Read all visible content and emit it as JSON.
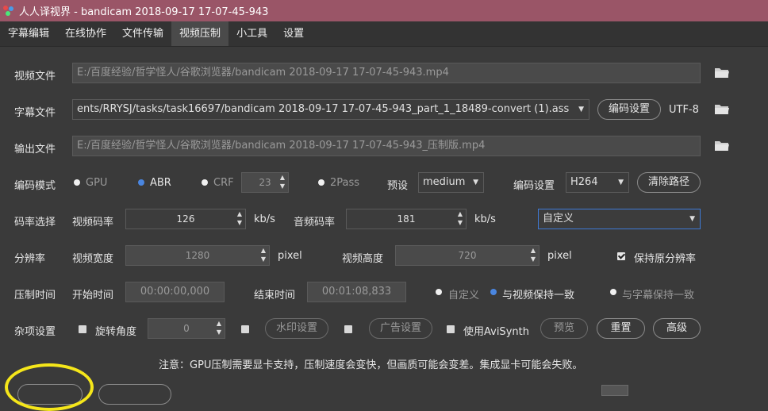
{
  "window": {
    "title": "人人译视界 - bandicam 2018-09-17 17-07-45-943"
  },
  "menu": [
    "字幕编辑",
    "在线协作",
    "文件传输",
    "视频压制",
    "小工具",
    "设置"
  ],
  "video_file": {
    "label": "视频文件",
    "value": "E:/百度经验/哲学怪人/谷歌浏览器/bandicam 2018-09-17 17-07-45-943.mp4"
  },
  "subtitle_file": {
    "label": "字幕文件",
    "value": "ents/RRYSJ/tasks/task16697/bandicam 2018-09-17 17-07-45-943_part_1_18489-convert (1).ass",
    "encode_btn": "编码设置",
    "encoding": "UTF-8"
  },
  "output_file": {
    "label": "输出文件",
    "value": "E:/百度经验/哲学怪人/谷歌浏览器/bandicam 2018-09-17 17-07-45-943_压制版.mp4"
  },
  "encode_mode": {
    "label": "编码模式",
    "gpu": "GPU",
    "abr": "ABR",
    "crf": "CRF",
    "crf_value": "23",
    "twopass": "2Pass",
    "preset_label": "预设",
    "preset": "medium",
    "codec_label": "编码设置",
    "codec": "H264",
    "clear_btn": "清除路径"
  },
  "bitrate": {
    "label": "码率选择",
    "video_label": "视频码率",
    "video_value": "126",
    "unit1": "kb/s",
    "audio_label": "音频码率",
    "audio_value": "181",
    "unit2": "kb/s",
    "mode": "自定义"
  },
  "resolution": {
    "label": "分辨率",
    "width_label": "视频宽度",
    "width": "1280",
    "unit1": "pixel",
    "height_label": "视频高度",
    "height": "720",
    "unit2": "pixel",
    "keep_label": "保持原分辨率"
  },
  "time": {
    "label": "压制时间",
    "start_label": "开始时间",
    "start": "00:00:00,000",
    "end_label": "结束时间",
    "end": "00:01:08,833",
    "opt_custom": "自定义",
    "opt_video": "与视频保持一致",
    "opt_sub": "与字幕保持一致"
  },
  "misc": {
    "label": "杂项设置",
    "rotate_label": "旋转角度",
    "rotate": "0",
    "watermark_btn": "水印设置",
    "ad_btn": "广告设置",
    "avisynth_label": "使用AviSynth",
    "preview_btn": "预览",
    "reset_btn": "重置",
    "advanced_btn": "高级"
  },
  "note": "注意：GPU压制需要显卡支持，压制速度会变快，但画质可能会变差。集成显卡可能会失败。",
  "colors": {
    "titlebar": "#9a5567",
    "accent": "#4a86e0",
    "highlight_ring": "#f5e61a"
  }
}
